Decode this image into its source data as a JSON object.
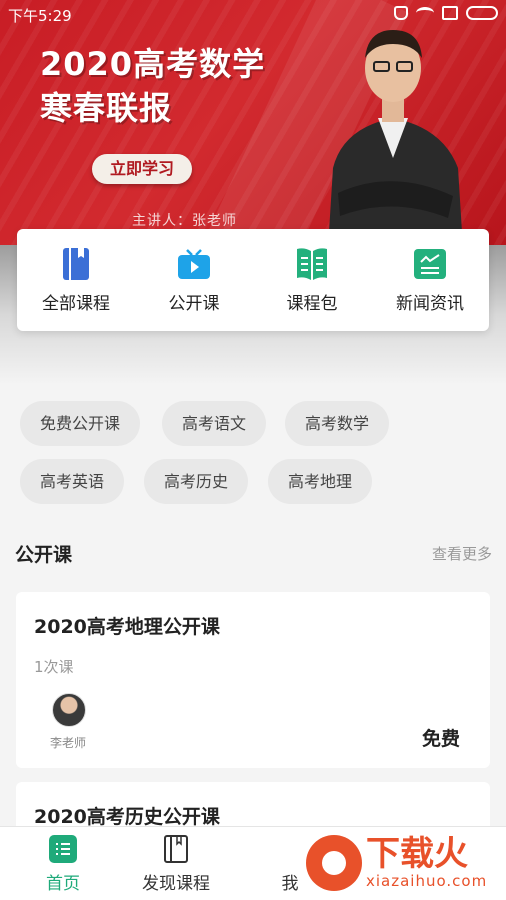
{
  "status_bar": {
    "time": "下午5:29"
  },
  "banner": {
    "title_line1": "2020高考数学",
    "title_line2": "寒春联报",
    "cta_label": "立即学习",
    "host": "主讲人：张老师"
  },
  "quick_menu": [
    {
      "label": "全部课程",
      "icon": "book-icon",
      "color": "#3b6fd6"
    },
    {
      "label": "公开课",
      "icon": "tv-icon",
      "color": "#1ea3e8"
    },
    {
      "label": "课程包",
      "icon": "open-book-icon",
      "color": "#23b07d"
    },
    {
      "label": "新闻资讯",
      "icon": "news-icon",
      "color": "#23b07d"
    }
  ],
  "tags": [
    "免费公开课",
    "高考语文",
    "高考数学",
    "高考英语",
    "高考历史",
    "高考地理"
  ],
  "section": {
    "title": "公开课",
    "more": "查看更多"
  },
  "courses": [
    {
      "title": "2020高考地理公开课",
      "count": "1次课",
      "teacher": "李老师",
      "price": "免费"
    },
    {
      "title": "2020高考历史公开课"
    }
  ],
  "bottom_nav": [
    {
      "label": "首页",
      "icon": "home-icon",
      "active": true
    },
    {
      "label": "发现课程",
      "icon": "bookmark-book-icon",
      "active": false
    },
    {
      "label": "我",
      "icon": "user-icon",
      "active": false
    }
  ],
  "watermark": {
    "text": "下载火",
    "url_text": "xiazaihuo.com"
  },
  "colors": {
    "brand_red": "#c81d25",
    "accent_green": "#1faa7a"
  }
}
